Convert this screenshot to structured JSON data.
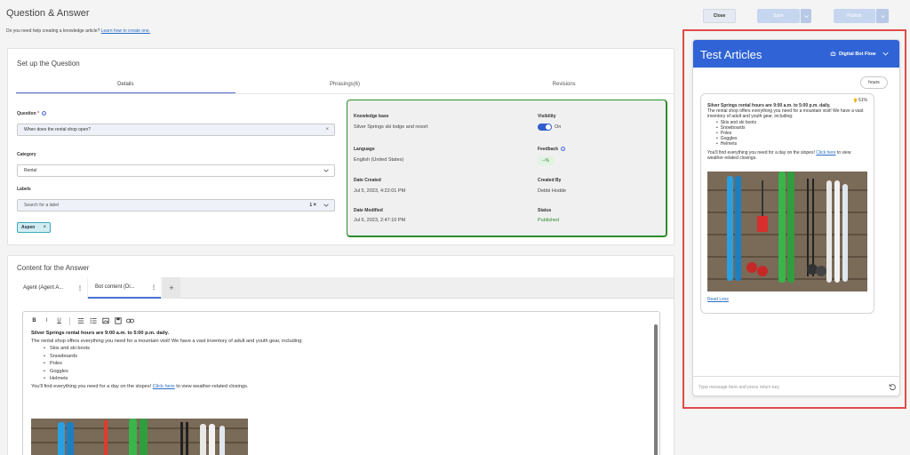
{
  "header": {
    "title": "Question & Answer",
    "help_text": "Do you need help creating a knowledge article?",
    "help_link": "Learn how to create one.",
    "close": "Close",
    "save": "Save",
    "publish": "Publish"
  },
  "setup": {
    "title": "Set up the Question",
    "tabs": [
      "Details",
      "Phrasings(6)",
      "Revisions"
    ],
    "question_label": "Question",
    "question_value": "When does the rental shop open?",
    "category_label": "Category",
    "category_value": "Rental",
    "labels_label": "Labels",
    "labels_placeholder": "Search for a label",
    "labels_count": "1",
    "tag": "Aspen"
  },
  "details": {
    "kb_label": "Knowledge base",
    "kb_value": "Silver Springs ski lodge and resort",
    "visibility_label": "Visibility",
    "visibility_value": "On",
    "language_label": "Language",
    "language_value": "English (United States)",
    "feedback_label": "Feedback",
    "feedback_value": "--%",
    "date_created_label": "Date Created",
    "date_created_value": "Jul 5, 2023, 4:22:01 PM",
    "created_by_label": "Created By",
    "created_by_value": "Debbi Hodde",
    "date_modified_label": "Date Modified",
    "date_modified_value": "Jul 6, 2023, 2:47:10 PM",
    "status_label": "Status",
    "status_value": "Published"
  },
  "content": {
    "title": "Content for the Answer",
    "tabs": [
      "Agent (Agent A...",
      "Bot content (Di..."
    ],
    "add_tab": "+",
    "headline": "Silver Springs rental hours are 9:00 a.m. to 5:00 p.m. daily.",
    "intro": "The rental shop offers everything you need for a mountain visit! We have a vast inventory of adult and youth gear, including:",
    "items": [
      "Skis and ski boots",
      "Snowboards",
      "Poles",
      "Goggles",
      "Helmets"
    ],
    "outro_before": "You'll find everything you need for a day on the slopes!",
    "outro_link": "Click here",
    "outro_after": "to view weather-related closings."
  },
  "chat": {
    "title": "Test Articles",
    "flow": "Digital Bot Flow",
    "user_msg": "hours",
    "score": "51%",
    "headline": "Silver Springs rental hours are 9:00 a.m. to 5:00 p.m. daily.",
    "intro": "The rental shop offers everything you need for a mountain visit! We have a vast inventory of adult and youth gear, including:",
    "items": [
      "Skis and ski boots",
      "Snowboards",
      "Poles",
      "Goggles",
      "Helmets"
    ],
    "outro_before": "You'll find everything you need for a day on the slopes!",
    "outro_link": "Click here",
    "outro_after": "to view weather-related closings.",
    "read_less": "Read Less",
    "input_placeholder": "Type message here and press return key"
  },
  "colors": {
    "accent": "#2f63d6",
    "success": "#2e8b2e",
    "highlight": "#e04a4a"
  }
}
